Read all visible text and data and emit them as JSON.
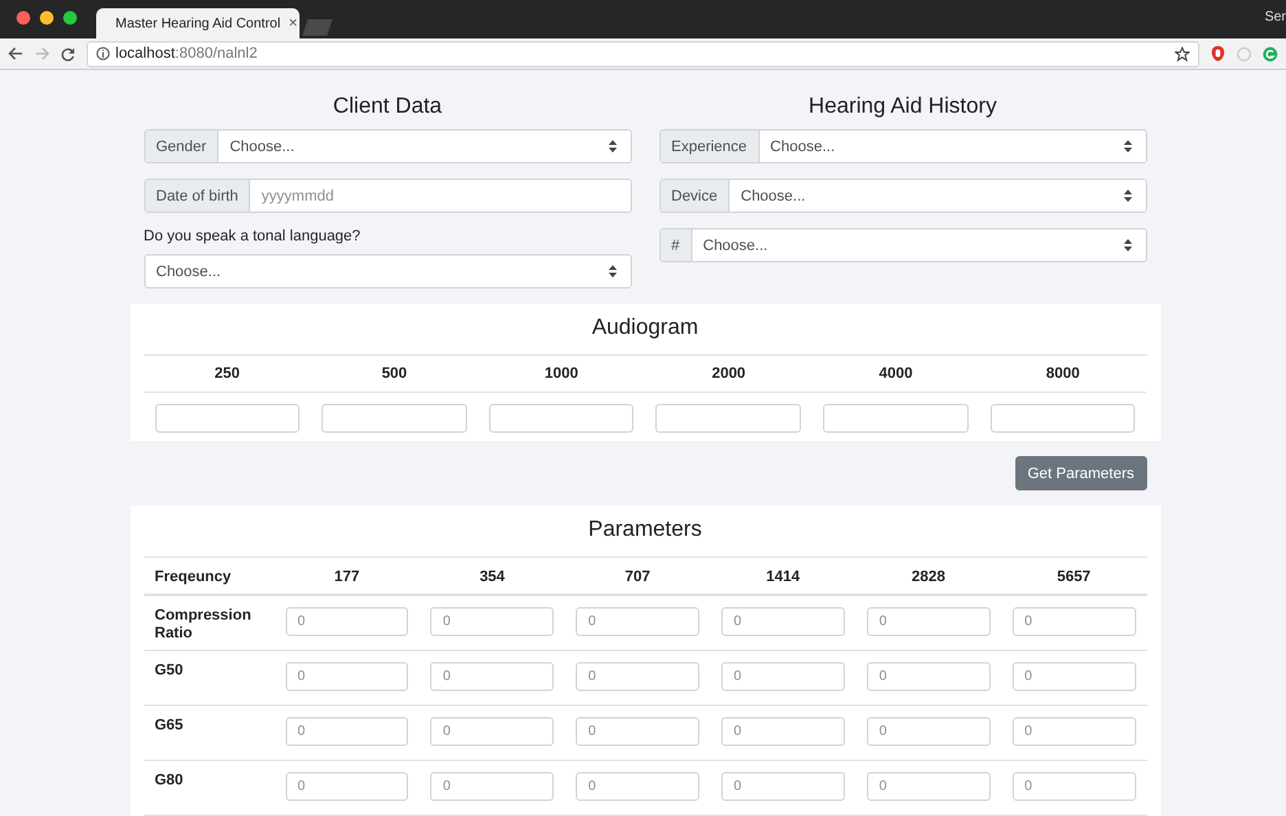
{
  "browser": {
    "tab_title": "Master Hearing Aid Control",
    "tab_close": "×",
    "url_host": "localhost",
    "url_path": ":8080/nalnl2",
    "profile": "Ser"
  },
  "client_data": {
    "title": "Client Data",
    "gender": {
      "label": "Gender",
      "value": "Choose..."
    },
    "date_of_birth": {
      "label": "Date of birth",
      "placeholder": "yyyymmdd"
    },
    "tonal_question": "Do you speak a tonal language?",
    "tonal": {
      "value": "Choose..."
    }
  },
  "history": {
    "title": "Hearing Aid History",
    "fields": [
      {
        "label": "Experience",
        "value": "Choose..."
      },
      {
        "label": "Device",
        "value": "Choose..."
      },
      {
        "label": "#",
        "value": "Choose..."
      }
    ]
  },
  "audiogram": {
    "title": "Audiogram",
    "frequencies": [
      "250",
      "500",
      "1000",
      "2000",
      "4000",
      "8000"
    ]
  },
  "get_parameters_button": "Get Parameters",
  "parameters": {
    "title": "Parameters",
    "header": "Freqeuncy",
    "frequencies": [
      "177",
      "354",
      "707",
      "1414",
      "2828",
      "5657"
    ],
    "rows": [
      {
        "label": "Compression Ratio",
        "placeholders": [
          "0",
          "0",
          "0",
          "0",
          "0",
          "0"
        ]
      },
      {
        "label": "G50",
        "placeholders": [
          "0",
          "0",
          "0",
          "0",
          "0",
          "0"
        ]
      },
      {
        "label": "G65",
        "placeholders": [
          "0",
          "0",
          "0",
          "0",
          "0",
          "0"
        ]
      },
      {
        "label": "G80",
        "placeholders": [
          "0",
          "0",
          "0",
          "0",
          "0",
          "0"
        ]
      }
    ]
  }
}
